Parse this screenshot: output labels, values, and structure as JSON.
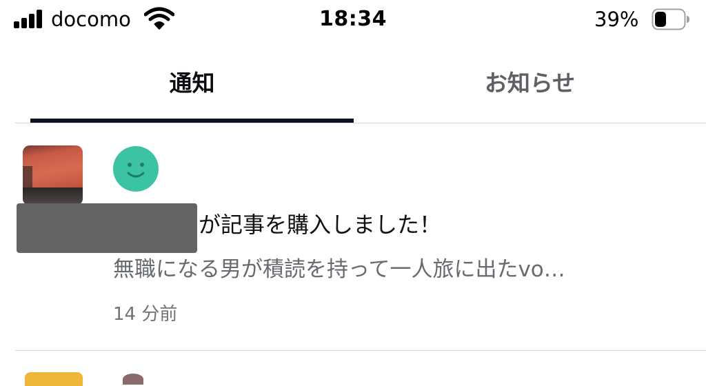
{
  "status_bar": {
    "carrier": "docomo",
    "time": "18:34",
    "battery_percent": "39%",
    "battery_level": 0.39,
    "icons": [
      "signal-icon",
      "wifi-icon",
      "battery-icon"
    ]
  },
  "tabs": [
    {
      "label": "通知",
      "selected": true
    },
    {
      "label": "お知らせ",
      "selected": false
    }
  ],
  "notifications": [
    {
      "actor_redacted": true,
      "action_text": "が記事を購入しました！",
      "excerpt": "無職になる男が積読を持って一人旅に出たvo…",
      "time": "14 分前",
      "avatar_icon": "smiley-icon"
    }
  ],
  "colors": {
    "tab_active": "#0c0c14",
    "tab_inactive": "#5d6166",
    "indicator": "#0d1323",
    "smiley": "#3cc3a4",
    "secondary_text": "#676b70"
  }
}
